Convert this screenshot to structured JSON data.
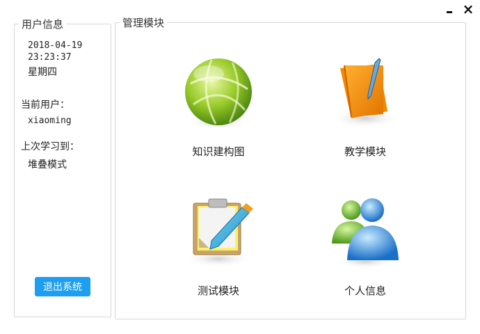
{
  "window": {
    "minimize_icon": "minimize-icon",
    "close_label": "×"
  },
  "user_info": {
    "title": "用户信息",
    "date": "2018-04-19",
    "time": "23:23:37",
    "weekday": "星期四",
    "current_user_label": "当前用户：",
    "current_user": "xiaoming",
    "last_study_label": "上次学习到：",
    "last_study_value": "堆叠模式",
    "logout_label": "退出系统"
  },
  "modules": {
    "title": "管理模块",
    "items": [
      {
        "label": "知识建构图",
        "icon": "globe-icon"
      },
      {
        "label": "教学模块",
        "icon": "folder-pen-icon"
      },
      {
        "label": "测试模块",
        "icon": "clipboard-pencil-icon"
      },
      {
        "label": "个人信息",
        "icon": "users-icon"
      }
    ]
  },
  "colors": {
    "accent": "#1e9ef0",
    "border": "#d6d6d6"
  }
}
